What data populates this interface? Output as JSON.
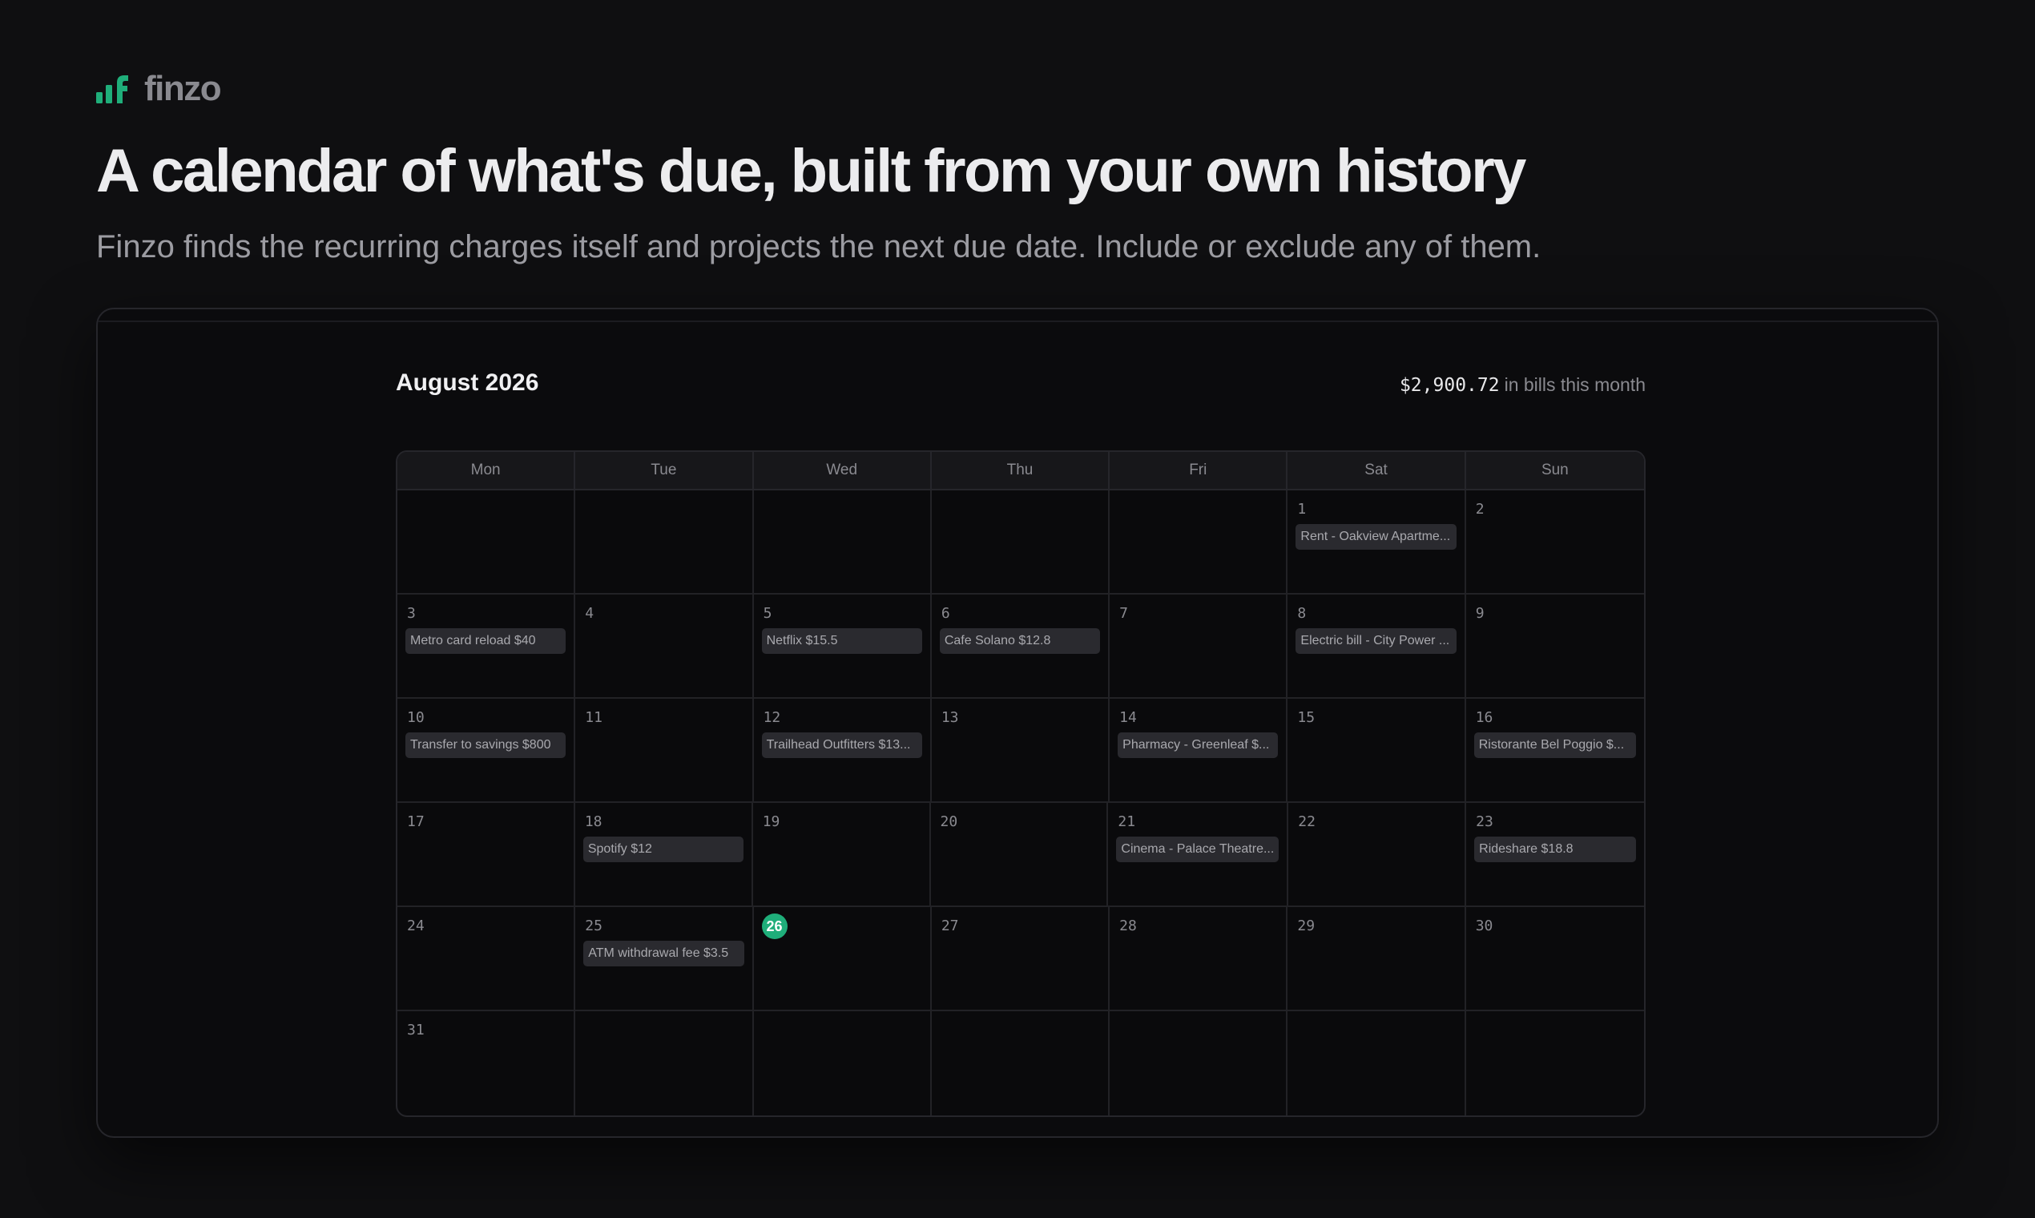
{
  "brand": {
    "name": "finzo",
    "accent": "#1fae7a"
  },
  "hero": {
    "title": "A calendar of what's due, built from your own history",
    "subtitle": "Finzo finds the recurring charges itself and projects the next due date. Include or exclude any of them."
  },
  "calendar": {
    "month_label": "August 2026",
    "total_amount": "$2,900.72",
    "total_suffix": "in bills this month",
    "weekdays": [
      "Mon",
      "Tue",
      "Wed",
      "Thu",
      "Fri",
      "Sat",
      "Sun"
    ],
    "today": "26",
    "weeks": [
      [
        {
          "day": "",
          "bill": ""
        },
        {
          "day": "",
          "bill": ""
        },
        {
          "day": "",
          "bill": ""
        },
        {
          "day": "",
          "bill": ""
        },
        {
          "day": "",
          "bill": ""
        },
        {
          "day": "1",
          "bill": "Rent - Oakview Apartme..."
        },
        {
          "day": "2",
          "bill": ""
        }
      ],
      [
        {
          "day": "3",
          "bill": "Metro card reload $40"
        },
        {
          "day": "4",
          "bill": ""
        },
        {
          "day": "5",
          "bill": "Netflix $15.5"
        },
        {
          "day": "6",
          "bill": "Cafe Solano $12.8"
        },
        {
          "day": "7",
          "bill": ""
        },
        {
          "day": "8",
          "bill": "Electric bill - City Power ..."
        },
        {
          "day": "9",
          "bill": ""
        }
      ],
      [
        {
          "day": "10",
          "bill": "Transfer to savings $800"
        },
        {
          "day": "11",
          "bill": ""
        },
        {
          "day": "12",
          "bill": "Trailhead Outfitters $13..."
        },
        {
          "day": "13",
          "bill": ""
        },
        {
          "day": "14",
          "bill": "Pharmacy - Greenleaf $..."
        },
        {
          "day": "15",
          "bill": ""
        },
        {
          "day": "16",
          "bill": "Ristorante Bel Poggio $..."
        }
      ],
      [
        {
          "day": "17",
          "bill": ""
        },
        {
          "day": "18",
          "bill": "Spotify $12"
        },
        {
          "day": "19",
          "bill": ""
        },
        {
          "day": "20",
          "bill": ""
        },
        {
          "day": "21",
          "bill": "Cinema - Palace Theatre..."
        },
        {
          "day": "22",
          "bill": ""
        },
        {
          "day": "23",
          "bill": "Rideshare $18.8"
        }
      ],
      [
        {
          "day": "24",
          "bill": ""
        },
        {
          "day": "25",
          "bill": "ATM withdrawal fee $3.5"
        },
        {
          "day": "26",
          "bill": ""
        },
        {
          "day": "27",
          "bill": ""
        },
        {
          "day": "28",
          "bill": ""
        },
        {
          "day": "29",
          "bill": ""
        },
        {
          "day": "30",
          "bill": ""
        }
      ],
      [
        {
          "day": "31",
          "bill": ""
        },
        {
          "day": "",
          "bill": ""
        },
        {
          "day": "",
          "bill": ""
        },
        {
          "day": "",
          "bill": ""
        },
        {
          "day": "",
          "bill": ""
        },
        {
          "day": "",
          "bill": ""
        },
        {
          "day": "",
          "bill": ""
        }
      ]
    ]
  }
}
